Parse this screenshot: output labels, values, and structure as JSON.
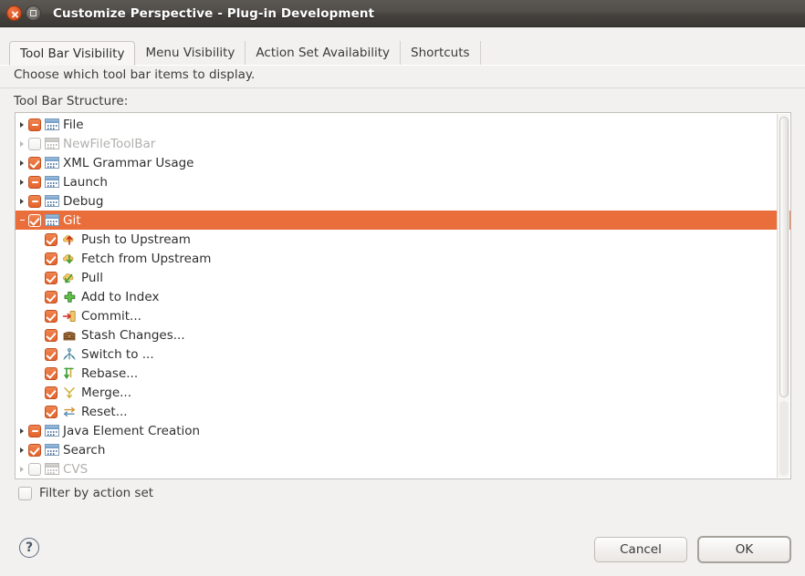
{
  "window": {
    "title": "Customize Perspective - Plug-in Development",
    "close_icon": "close-icon",
    "maximize_icon": "maximize-icon"
  },
  "tabs": [
    {
      "label": "Tool Bar Visibility",
      "active": true
    },
    {
      "label": "Menu Visibility",
      "active": false
    },
    {
      "label": "Action Set Availability",
      "active": false
    },
    {
      "label": "Shortcuts",
      "active": false
    }
  ],
  "hint": "Choose which tool bar items to display.",
  "tree": {
    "label": "Tool Bar Structure:",
    "rows": [
      {
        "label": "File",
        "check": "mixed",
        "icon": "toolbar-icon",
        "arrow": "collapsed",
        "level": 0,
        "selected": false,
        "disabled": false
      },
      {
        "label": "NewFileToolBar",
        "check": "empty",
        "icon": "toolbar-icon",
        "arrow": "collapsed",
        "level": 0,
        "selected": false,
        "disabled": true
      },
      {
        "label": "XML Grammar Usage",
        "check": "checked",
        "icon": "toolbar-icon",
        "arrow": "collapsed",
        "level": 0,
        "selected": false,
        "disabled": false
      },
      {
        "label": "Launch",
        "check": "mixed",
        "icon": "toolbar-icon",
        "arrow": "collapsed",
        "level": 0,
        "selected": false,
        "disabled": false
      },
      {
        "label": "Debug",
        "check": "mixed",
        "icon": "toolbar-icon",
        "arrow": "collapsed",
        "level": 0,
        "selected": false,
        "disabled": false
      },
      {
        "label": "Git",
        "check": "checked",
        "icon": "toolbar-icon",
        "arrow": "expanded",
        "level": 0,
        "selected": true,
        "disabled": false
      },
      {
        "label": "Push to Upstream",
        "check": "checked",
        "icon": "push-icon",
        "arrow": "none",
        "level": 1,
        "selected": false,
        "disabled": false
      },
      {
        "label": "Fetch from Upstream",
        "check": "checked",
        "icon": "fetch-icon",
        "arrow": "none",
        "level": 1,
        "selected": false,
        "disabled": false
      },
      {
        "label": "Pull",
        "check": "checked",
        "icon": "pull-icon",
        "arrow": "none",
        "level": 1,
        "selected": false,
        "disabled": false
      },
      {
        "label": "Add to Index",
        "check": "checked",
        "icon": "add-icon",
        "arrow": "none",
        "level": 1,
        "selected": false,
        "disabled": false
      },
      {
        "label": "Commit...",
        "check": "checked",
        "icon": "commit-icon",
        "arrow": "none",
        "level": 1,
        "selected": false,
        "disabled": false
      },
      {
        "label": "Stash Changes...",
        "check": "checked",
        "icon": "stash-icon",
        "arrow": "none",
        "level": 1,
        "selected": false,
        "disabled": false
      },
      {
        "label": "Switch to ...",
        "check": "checked",
        "icon": "switch-icon",
        "arrow": "none",
        "level": 1,
        "selected": false,
        "disabled": false
      },
      {
        "label": "Rebase...",
        "check": "checked",
        "icon": "rebase-icon",
        "arrow": "none",
        "level": 1,
        "selected": false,
        "disabled": false
      },
      {
        "label": "Merge...",
        "check": "checked",
        "icon": "merge-icon",
        "arrow": "none",
        "level": 1,
        "selected": false,
        "disabled": false
      },
      {
        "label": "Reset...",
        "check": "checked",
        "icon": "reset-icon",
        "arrow": "none",
        "level": 1,
        "selected": false,
        "disabled": false
      },
      {
        "label": "Java Element Creation",
        "check": "mixed",
        "icon": "toolbar-icon",
        "arrow": "collapsed",
        "level": 0,
        "selected": false,
        "disabled": false
      },
      {
        "label": "Search",
        "check": "checked",
        "icon": "toolbar-icon",
        "arrow": "collapsed",
        "level": 0,
        "selected": false,
        "disabled": false
      },
      {
        "label": "CVS",
        "check": "empty",
        "icon": "toolbar-icon",
        "arrow": "collapsed",
        "level": 0,
        "selected": false,
        "disabled": true
      }
    ]
  },
  "filter": {
    "label": "Filter by action set",
    "checked": false
  },
  "help": {
    "icon": "help-icon",
    "glyph": "?"
  },
  "buttons": {
    "cancel": "Cancel",
    "ok": "OK"
  },
  "colors": {
    "selection": "#ea6e3c",
    "checkbox_accent": "#e4632c",
    "titlebar_dark": "#3b3935",
    "dialog_bg": "#f2f1f0"
  }
}
